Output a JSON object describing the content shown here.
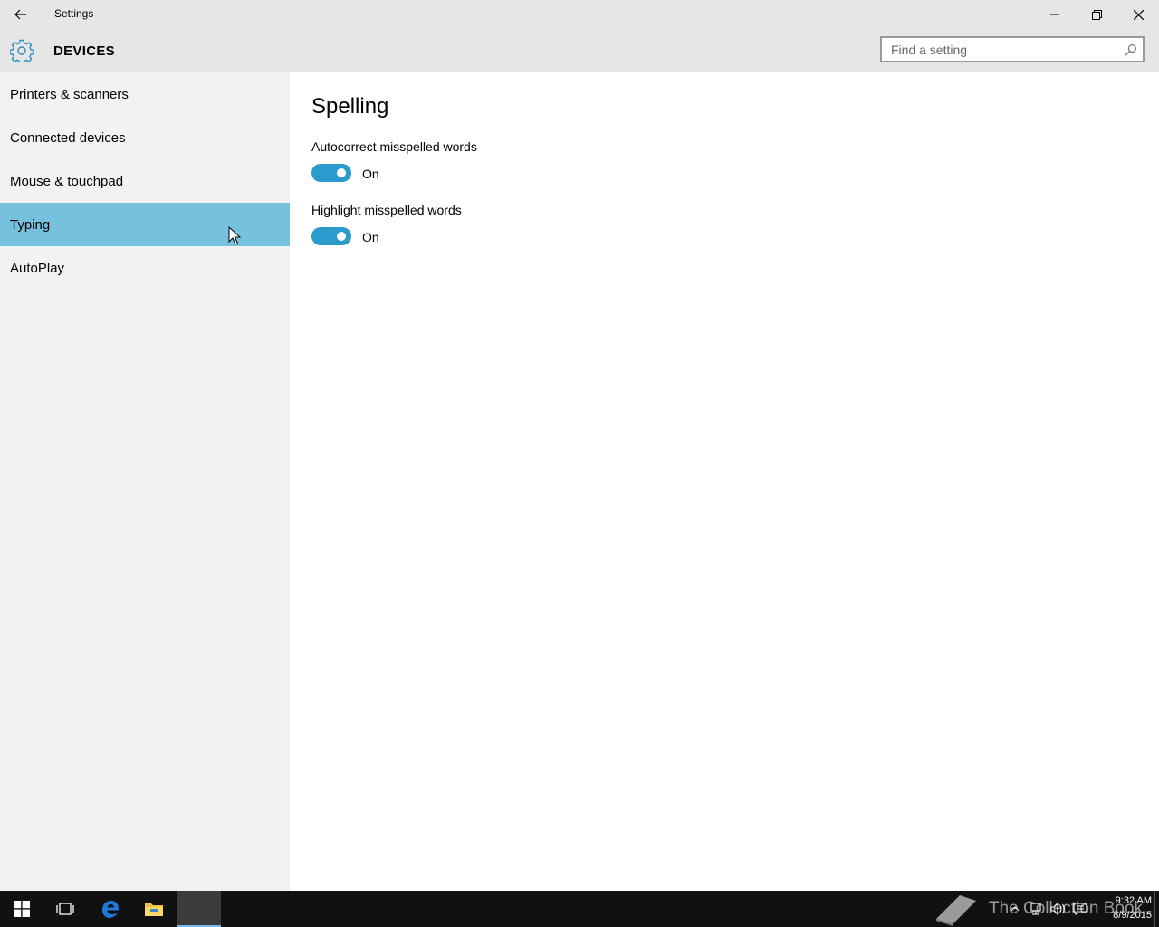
{
  "window": {
    "title": "Settings"
  },
  "header": {
    "section_title": "DEVICES",
    "search_placeholder": "Find a setting"
  },
  "sidebar": {
    "items": [
      {
        "label": "Printers & scanners",
        "active": false
      },
      {
        "label": "Connected devices",
        "active": false
      },
      {
        "label": "Mouse & touchpad",
        "active": false
      },
      {
        "label": "Typing",
        "active": true
      },
      {
        "label": "AutoPlay",
        "active": false
      }
    ]
  },
  "main": {
    "heading": "Spelling",
    "settings": [
      {
        "label": "Autocorrect misspelled words",
        "state": "On",
        "enabled": true
      },
      {
        "label": "Highlight misspelled words",
        "state": "On",
        "enabled": true
      }
    ]
  },
  "taskbar": {
    "time": "9:32 AM",
    "date": "8/9/2015",
    "watermark": "The Collection Book"
  },
  "colors": {
    "accent": "#2a9bcc",
    "selection": "#76c1dd",
    "titlebar": "#e6e6e6",
    "sidebar": "#f2f2f2",
    "taskbar": "#111111"
  }
}
